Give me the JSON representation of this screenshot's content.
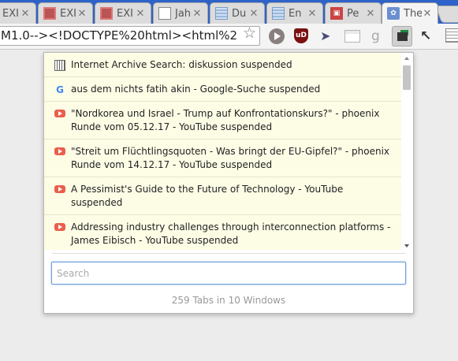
{
  "browser": {
    "tabs": [
      {
        "title": "EXI",
        "icon": "image-favicon",
        "active": false
      },
      {
        "title": "EXI",
        "icon": "image-favicon",
        "active": false
      },
      {
        "title": "EXI",
        "icon": "image-favicon",
        "active": false
      },
      {
        "title": "Jah",
        "icon": "page-favicon",
        "active": false
      },
      {
        "title": "Du",
        "icon": "wikipedia-favicon",
        "active": false
      },
      {
        "title": "En",
        "icon": "wikipedia-favicon",
        "active": false
      },
      {
        "title": "Pe",
        "icon": "pe-favicon",
        "active": false
      },
      {
        "title": "The",
        "icon": "the-favicon",
        "active": true
      }
    ],
    "close_glyph": "✕",
    "address": "M1.0--><!DOCTYPE%20html><html%2",
    "extensions": [
      "play-icon",
      "ublock-icon",
      "cursor-icon",
      "grid-icon",
      "g-icon",
      "tab-manager-icon",
      "arrow-icon",
      "document-icon"
    ]
  },
  "popup": {
    "items": [
      {
        "icon": "archive-icon",
        "title": "Internet Archive Search: diskussion suspended"
      },
      {
        "icon": "google-icon",
        "title": "aus dem nichts fatih akin - Google-Suche suspended"
      },
      {
        "icon": "youtube-icon",
        "title": "\"Nordkorea und Israel - Trump auf Konfrontationskurs?\" - phoenix Runde vom 05.12.17 - YouTube suspended"
      },
      {
        "icon": "youtube-icon",
        "title": "\"Streit um Flüchtlingsquoten - Was bringt der EU-Gipfel?\" - phoenix Runde vom 14.12.17 - YouTube suspended"
      },
      {
        "icon": "youtube-icon",
        "title": "A Pessimist's Guide to the Future of Technology - YouTube suspended"
      },
      {
        "icon": "youtube-icon",
        "title": "Addressing industry challenges through interconnection platforms - James Eibisch - YouTube suspended"
      }
    ],
    "search": {
      "placeholder": "Search",
      "value": ""
    },
    "status": "259 Tabs in 10 Windows"
  },
  "colors": {
    "tabstrip": "#2d63c8",
    "list_bg": "#fdfde6",
    "youtube": "#e8604c",
    "search_border": "#6d9fd8"
  }
}
